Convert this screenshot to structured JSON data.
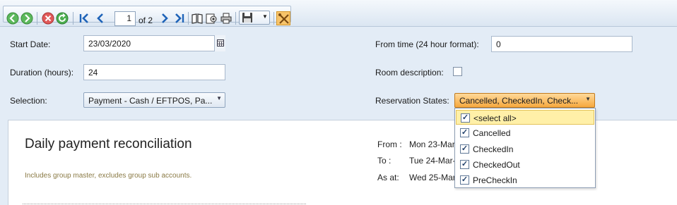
{
  "toolbar": {
    "page_number": "1",
    "page_total": "of 2",
    "icons": [
      "back-icon",
      "forward-icon",
      "stop-icon",
      "refresh-icon",
      "first-page-icon",
      "previous-page-icon",
      "next-page-icon",
      "last-page-icon",
      "print-layout-icon",
      "page-setup-icon",
      "print-icon",
      "save-icon",
      "parameters-icon"
    ]
  },
  "form": {
    "start_date_label": "Start Date:",
    "start_date_value": "23/03/2020",
    "duration_label": "Duration (hours):",
    "duration_value": "24",
    "selection_label": "Selection:",
    "selection_value": "Payment - Cash / EFTPOS, Pa...",
    "from_time_label": "From time (24 hour format):",
    "from_time_value": "0",
    "room_desc_label": "Room description:",
    "room_desc_checked": false,
    "res_states_label": "Reservation States:",
    "res_states_value": "Cancelled, CheckedIn, Check..."
  },
  "dropdown": {
    "items": [
      {
        "label": "<select all>",
        "checked": true
      },
      {
        "label": "Cancelled",
        "checked": true
      },
      {
        "label": "CheckedIn",
        "checked": true
      },
      {
        "label": "CheckedOut",
        "checked": true
      },
      {
        "label": "PreCheckIn",
        "checked": true
      }
    ]
  },
  "report": {
    "title": "Daily payment reconciliation",
    "subtitle": "Includes group master, excludes group sub accounts.",
    "from_label": "From :",
    "from_value": "Mon 23-Mar-",
    "to_label": "To :",
    "to_value": "Tue 24-Mar-",
    "asat_label": "As at:",
    "asat_value": "Wed 25-Mar-"
  },
  "colors": {
    "accent_orange": "#f6a83e",
    "highlight_yellow": "#fff0a8",
    "panel_blue": "#e3ecf6"
  }
}
